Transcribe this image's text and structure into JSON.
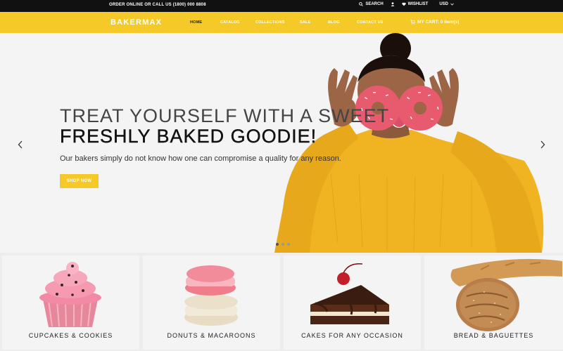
{
  "topbar": {
    "phone": "ORDER ONLINE OR CALL US (1800) 000 8808",
    "search": "SEARCH",
    "wishlist": "WISHLIST",
    "currency": "USD"
  },
  "nav": {
    "logo": "BAKERMAX",
    "items": [
      {
        "label": "HOME",
        "active": true
      },
      {
        "label": "CATALOG"
      },
      {
        "label": "COLLECTIONS"
      },
      {
        "label": "SALE"
      },
      {
        "label": "BLOG"
      },
      {
        "label": "CONTACT US"
      }
    ],
    "cart": "MY CART: 0 item(s)"
  },
  "hero": {
    "title_line1": "TREAT YOURSELF WITH A SWEET",
    "title_line2": "FRESHLY BAKED GOODIE!",
    "subtitle": "Our bakers simply do not know how one can compromise a quality for any reason.",
    "button": "SHOP NOW",
    "prev_icon": "chevron-left-icon",
    "next_icon": "chevron-right-icon",
    "slides": 3,
    "active_slide": 1
  },
  "categories": [
    {
      "label": "CUPCAKES & COOKIES",
      "icon": "cupcake-image"
    },
    {
      "label": "DONUTS & MACAROONS",
      "icon": "macaroons-image"
    },
    {
      "label": "CAKES FOR ANY OCCASION",
      "icon": "cake-slice-image"
    },
    {
      "label": "BREAD & BAGUETTES",
      "icon": "bread-image"
    }
  ],
  "colors": {
    "accent": "#f5c928",
    "topbar": "#111111",
    "sweater": "#f0b321",
    "donut": "#e85a6e"
  }
}
